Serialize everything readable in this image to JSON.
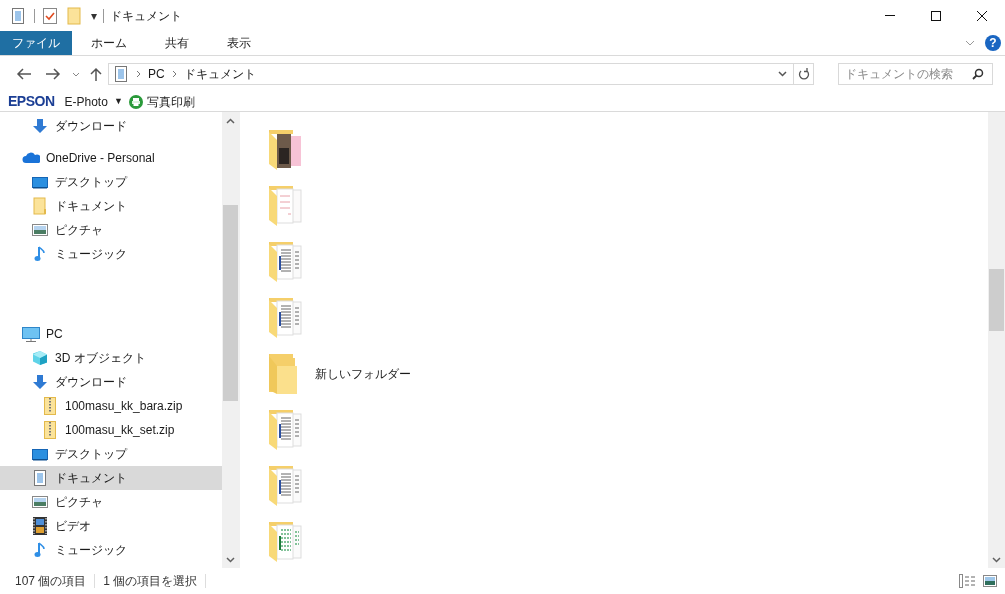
{
  "window": {
    "title": "ドキュメント",
    "qat_dropdown": "▾",
    "help": "?"
  },
  "ribbon": {
    "tabs": [
      {
        "label": "ファイル",
        "selected": true
      },
      {
        "label": "ホーム",
        "selected": false
      },
      {
        "label": "共有",
        "selected": false
      },
      {
        "label": "表示",
        "selected": false
      }
    ]
  },
  "address_bar": {
    "path": [
      "PC",
      "ドキュメント"
    ]
  },
  "search": {
    "placeholder": "ドキュメントの検索"
  },
  "epson_toolbar": {
    "logo": "EPSON",
    "app": "E-Photo",
    "app_caret": "▼",
    "action": "写真印刷"
  },
  "sidebar": {
    "cut_items": [
      {
        "label": "ダウンロード",
        "kind": "download",
        "selected": false
      }
    ],
    "tree": [
      {
        "label": "OneDrive - Personal",
        "kind": "onedrive",
        "selected": false,
        "children": [
          {
            "label": "デスクトップ",
            "kind": "desktop",
            "selected": false
          },
          {
            "label": "ドキュメント",
            "kind": "folder",
            "selected": false
          },
          {
            "label": "ピクチャ",
            "kind": "pictures",
            "selected": false
          },
          {
            "label": "ミュージック",
            "kind": "music",
            "selected": false
          }
        ]
      },
      {
        "label": "PC",
        "kind": "pc",
        "selected": false,
        "children": [
          {
            "label": "3D オブジェクト",
            "kind": "objects3d",
            "selected": false
          },
          {
            "label": "ダウンロード",
            "kind": "download",
            "selected": false,
            "children": [
              {
                "label": "100masu_kk_bara.zip",
                "kind": "zip",
                "selected": false
              },
              {
                "label": "100masu_kk_set.zip",
                "kind": "zip",
                "selected": false
              }
            ]
          },
          {
            "label": "デスクトップ",
            "kind": "desktop",
            "selected": false
          },
          {
            "label": "ドキュメント",
            "kind": "documents",
            "selected": true
          },
          {
            "label": "ピクチャ",
            "kind": "pictures",
            "selected": false
          },
          {
            "label": "ビデオ",
            "kind": "videos",
            "selected": false
          },
          {
            "label": "ミュージック",
            "kind": "music",
            "selected": false
          }
        ]
      }
    ]
  },
  "files": [
    {
      "kind": "photo"
    },
    {
      "kind": "papers"
    },
    {
      "kind": "docs"
    },
    {
      "kind": "docs"
    },
    {
      "kind": "plain",
      "name": "新しいフォルダー"
    },
    {
      "kind": "docs"
    },
    {
      "kind": "docs"
    },
    {
      "kind": "sheets"
    }
  ],
  "status_bar": {
    "count": "107 個の項目",
    "selection": "1 個の項目を選択"
  }
}
